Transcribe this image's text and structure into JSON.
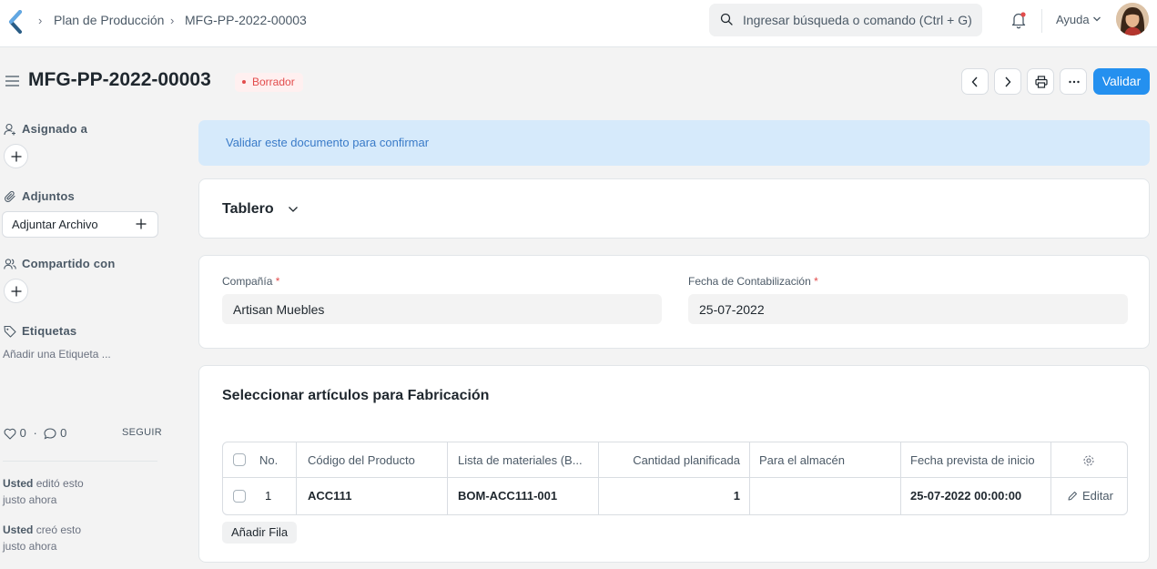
{
  "navbar": {
    "breadcrumbs": [
      "Plan de Producción",
      "MFG-PP-2022-00003"
    ],
    "search_placeholder": "Ingresar búsqueda o comando (Ctrl + G)",
    "help_label": "Ayuda"
  },
  "header": {
    "title": "MFG-PP-2022-00003",
    "status": "Borrador",
    "primary_action": "Validar"
  },
  "sidebar": {
    "assigned_label": "Asignado a",
    "attachments_label": "Adjuntos",
    "attach_button": "Adjuntar Archivo",
    "shared_label": "Compartido con",
    "tags_label": "Etiquetas",
    "add_tag": "Añadir una Etiqueta ...",
    "likes_count": "0",
    "comments_count": "0",
    "follow_label": "SEGUIR",
    "activity": [
      {
        "user": "Usted",
        "action": "editó esto",
        "time": "justo ahora"
      },
      {
        "user": "Usted",
        "action": "creó esto",
        "time": "justo ahora"
      }
    ]
  },
  "alert": "Validar este documento para confirmar",
  "dashboard": {
    "title": "Tablero"
  },
  "fields": {
    "company_label": "Compañía",
    "company_value": "Artisan Muebles",
    "posting_date_label": "Fecha de Contabilización",
    "posting_date_value": "25-07-2022",
    "required_mark": "*"
  },
  "items_section": {
    "title": "Seleccionar artículos para Fabricación",
    "columns": [
      "No.",
      "Código del Producto",
      "Lista de materiales (B...",
      "Cantidad planificada",
      "Para el almacén",
      "Fecha prevista de inicio"
    ],
    "rows": [
      {
        "no": "1",
        "item_code": "ACC111",
        "bom": "BOM-ACC111-001",
        "qty": "1",
        "warehouse": "",
        "start_date": "25-07-2022 00:00:00",
        "edit": "Editar"
      }
    ],
    "add_row": "Añadir Fila"
  },
  "colors": {
    "primary": "#2490ef",
    "alert_bg": "#d6eafb",
    "draft_red": "#e24c4c"
  }
}
